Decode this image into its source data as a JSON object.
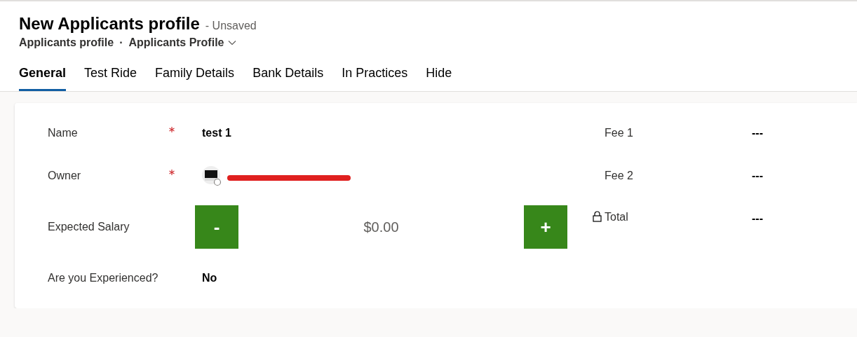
{
  "header": {
    "title": "New Applicants profile",
    "status": "- Unsaved",
    "entity": "Applicants profile",
    "separator": "·",
    "form_name": "Applicants Profile"
  },
  "tabs": [
    {
      "label": "General",
      "selected": true
    },
    {
      "label": "Test Ride",
      "selected": false
    },
    {
      "label": "Family Details",
      "selected": false
    },
    {
      "label": "Bank Details",
      "selected": false
    },
    {
      "label": "In Practices",
      "selected": false
    },
    {
      "label": "Hide",
      "selected": false
    }
  ],
  "fields_left": [
    {
      "kind": "text",
      "label": "Name",
      "required": true,
      "value": "test 1"
    },
    {
      "kind": "lookup",
      "label": "Owner",
      "required": true,
      "redacted": true
    },
    {
      "kind": "stepper",
      "label": "Expected Salary",
      "required": false,
      "minus": "-",
      "value": "$0.00",
      "plus": "+"
    },
    {
      "kind": "text",
      "label": "Are you Experienced?",
      "required": false,
      "value": "No"
    }
  ],
  "fields_right": [
    {
      "label": "Fee 1",
      "locked": false,
      "value": "---"
    },
    {
      "label": "Fee 2",
      "locked": false,
      "value": "---"
    },
    {
      "label": "Total",
      "locked": true,
      "value": "---"
    }
  ]
}
